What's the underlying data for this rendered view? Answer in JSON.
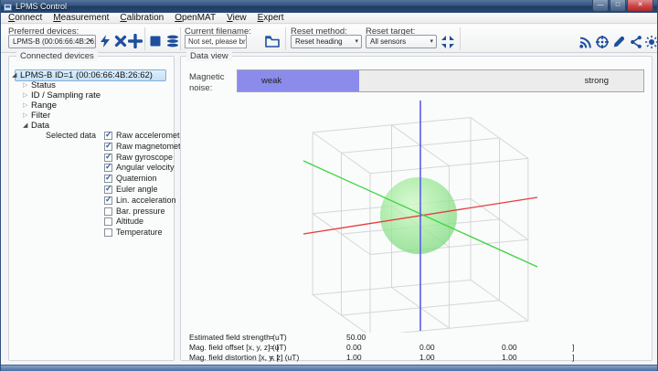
{
  "window": {
    "title": "LPMS Control"
  },
  "menu": {
    "items": [
      "Connect",
      "Measurement",
      "Calibration",
      "OpenMAT",
      "View",
      "Expert"
    ]
  },
  "toolbar": {
    "preferred_devices_label": "Preferred devices:",
    "device_value": "LPMS-B (00:06:66:4B:26:62)",
    "current_filename_label": "Current filename:",
    "filename_value": "Not set, please browse..",
    "reset_method_label": "Reset method:",
    "reset_method_value": "Reset heading",
    "reset_target_label": "Reset target:",
    "reset_target_value": "All sensors",
    "icons": [
      "connect-lightning",
      "remove-device",
      "add-device",
      "stop-record",
      "layers-stream",
      "browse-folder",
      "fit-view",
      "wireless-signal",
      "target-calibration",
      "edit-pencil",
      "share-graph",
      "sun-settings"
    ]
  },
  "sidebar": {
    "group_title": "Connected devices",
    "device_node": "LPMS-B ID=1 (00:06:66:4B:26:62)",
    "nodes": [
      "Status",
      "ID / Sampling rate",
      "Range",
      "Filter",
      "Data"
    ],
    "selected_data_label": "Selected data",
    "checkboxes": [
      {
        "label": "Raw accelerometer",
        "checked": true
      },
      {
        "label": "Raw magnetometer",
        "checked": true
      },
      {
        "label": "Raw gyroscope",
        "checked": true
      },
      {
        "label": "Angular velocity",
        "checked": true
      },
      {
        "label": "Quaternion",
        "checked": true
      },
      {
        "label": "Euler angle",
        "checked": true
      },
      {
        "label": "Lin. acceleration",
        "checked": true
      },
      {
        "label": "Bar. pressure",
        "checked": false
      },
      {
        "label": "Altitude",
        "checked": false
      },
      {
        "label": "Temperature",
        "checked": false
      }
    ]
  },
  "dataview": {
    "group_title": "Data view",
    "magnetic_noise_label": "Magnetic noise:",
    "noise_weak": "weak",
    "noise_strong": "strong",
    "noise_level_pct": 30,
    "readouts": [
      {
        "label": "Estimated field strength (uT)",
        "eq": "=",
        "v0": "50.00",
        "v1": "",
        "v2": "",
        "close": ""
      },
      {
        "label": "Mag. field offset [x, y, z] (uT)",
        "eq": "= [",
        "v0": "0.00",
        "v1": "0.00",
        "v2": "0.00",
        "close": "]"
      },
      {
        "label": "Mag. field distortion [x, y, z] (uT)",
        "eq": "= [",
        "v0": "1.00",
        "v1": "1.00",
        "v2": "1.00",
        "close": "]"
      }
    ]
  },
  "colors": {
    "accent_blue": "#1d4f9e",
    "noise_fill": "#8b8bec",
    "axis_x_red": "#e53c3c",
    "axis_y_blue": "#5c5cea",
    "axis_z_green": "#3ed43e",
    "sphere_green": "#8fe08f",
    "wire_gray": "#d2d2d2",
    "selection_blue": "#c4dff5"
  }
}
